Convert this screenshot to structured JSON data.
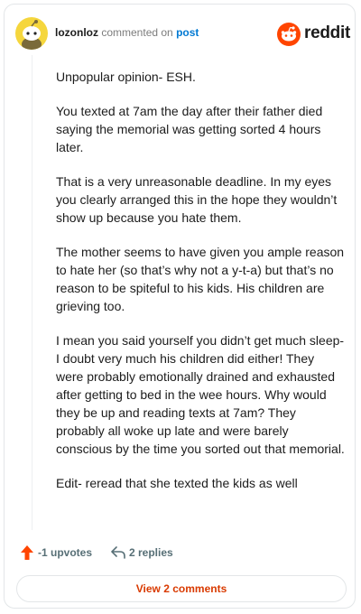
{
  "header": {
    "username": "lozonloz",
    "action_text": "commented on",
    "post_link": "post",
    "brand": "reddit"
  },
  "comment": {
    "paragraphs": [
      "Unpopular opinion- ESH.",
      "You texted at 7am the day after their father died saying the memorial was getting sorted 4 hours later.",
      "That is a very unreasonable deadline. In my eyes you clearly arranged this in the hope they wouldn’t show up because you hate them.",
      "The mother seems to have given you ample reason to hate her (so that’s why not a y-t-a) but that’s no reason to be spiteful to his kids. His children are grieving too.",
      "I mean you said yourself you didn’t get much sleep- I doubt very much his children did either! They were probably emotionally drained and exhausted after getting to bed in the wee hours. Why would they be up and reading texts at 7am? They probably all woke up late and were barely conscious by the time you sorted out that memorial.",
      "Edit- reread that she texted the kids as well"
    ]
  },
  "actions": {
    "upvotes": "-1 upvotes",
    "replies": "2 replies"
  },
  "view_button": "View 2 comments",
  "icons": {
    "upvote": "upvote-arrow-icon",
    "reply": "reply-arrow-icon",
    "avatar": "snoo-avatar-icon",
    "brand": "reddit-logo-icon"
  },
  "colors": {
    "upvote": "#ff4500",
    "link": "#0079d3",
    "view_button_text": "#d93a00",
    "avatar_bg": "#f5d63d"
  }
}
